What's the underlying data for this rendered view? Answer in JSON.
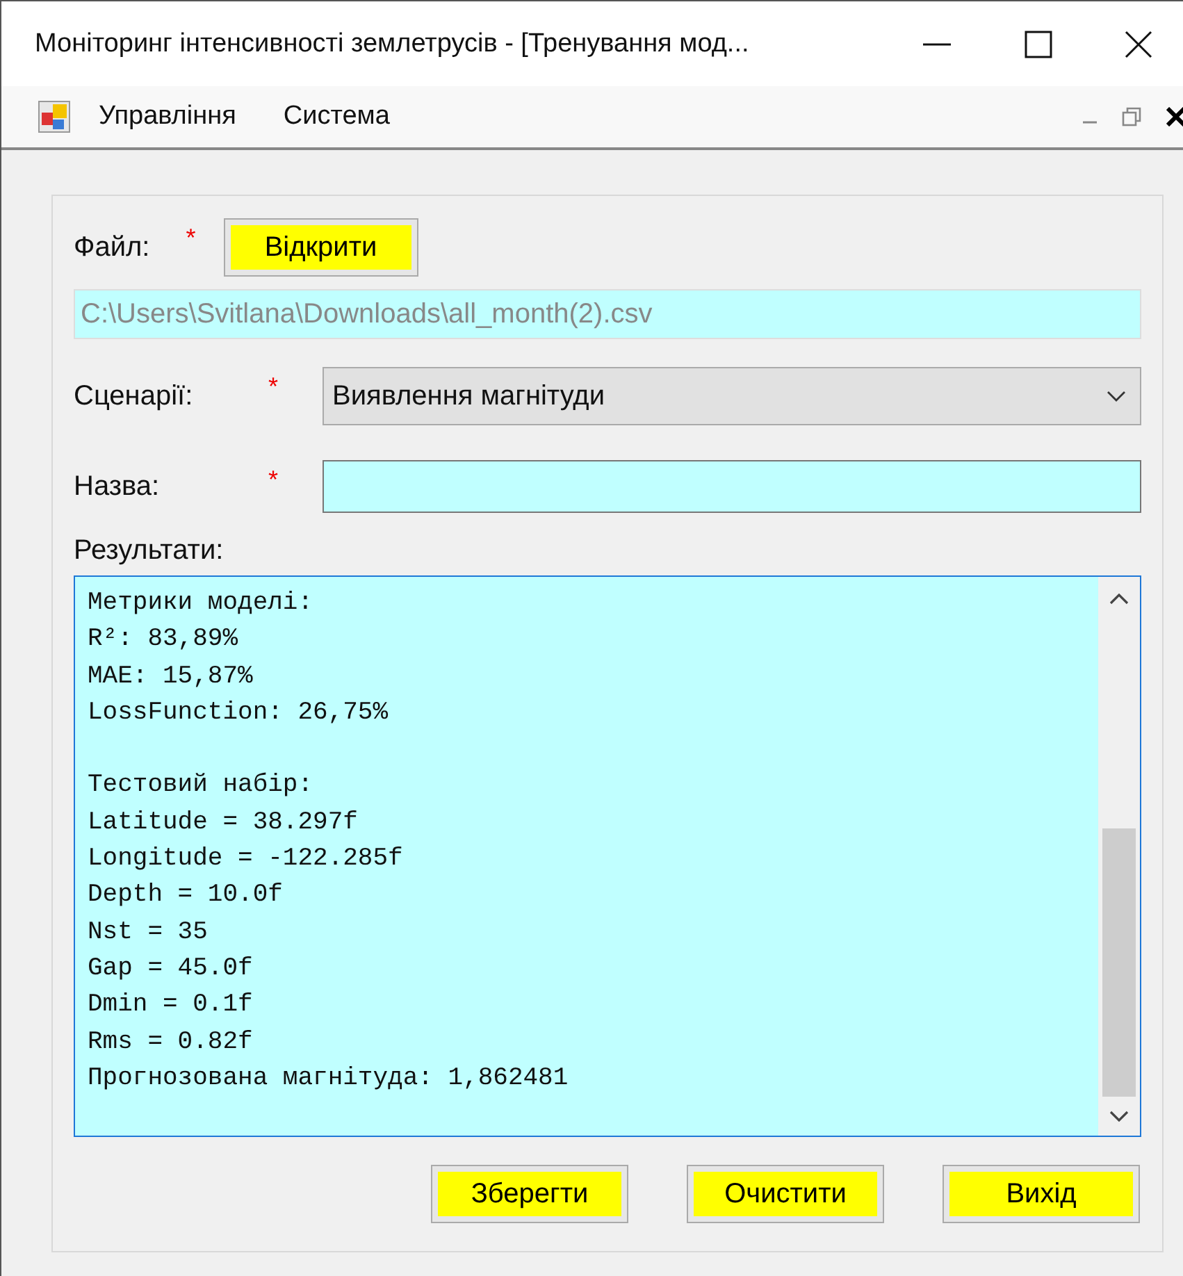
{
  "window": {
    "title": "Моніторинг інтенсивності землетрусів - [Тренування мод..."
  },
  "menu": {
    "items": [
      "Управління",
      "Система"
    ]
  },
  "form": {
    "file_label": "Файл:",
    "file_required": true,
    "required_mark": "*",
    "open_button": "Відкрити",
    "file_path": "C:\\Users\\Svitlana\\Downloads\\all_month(2).csv",
    "scenario_label": "Сценарії:",
    "scenario_required": true,
    "scenario_value": "Виявлення магнітуди",
    "name_label": "Назва:",
    "name_required": true,
    "results_label": "Результати:",
    "results_blocks": [
      [
        "Метрики моделі:",
        "R²: 83,89%",
        "MAE: 15,87%",
        "LossFunction: 26,75%"
      ],
      [
        "Тестовий набір:",
        "Latitude = 38.297f",
        "Longitude = -122.285f",
        "Depth = 10.0f",
        "Nst = 35",
        "Gap = 45.0f",
        "Dmin = 0.1f",
        "Rms = 0.82f",
        "Прогнозована магнітуда: 1,862481"
      ]
    ]
  },
  "buttons": [
    "Зберегти",
    "Очистити",
    "Вихід"
  ]
}
